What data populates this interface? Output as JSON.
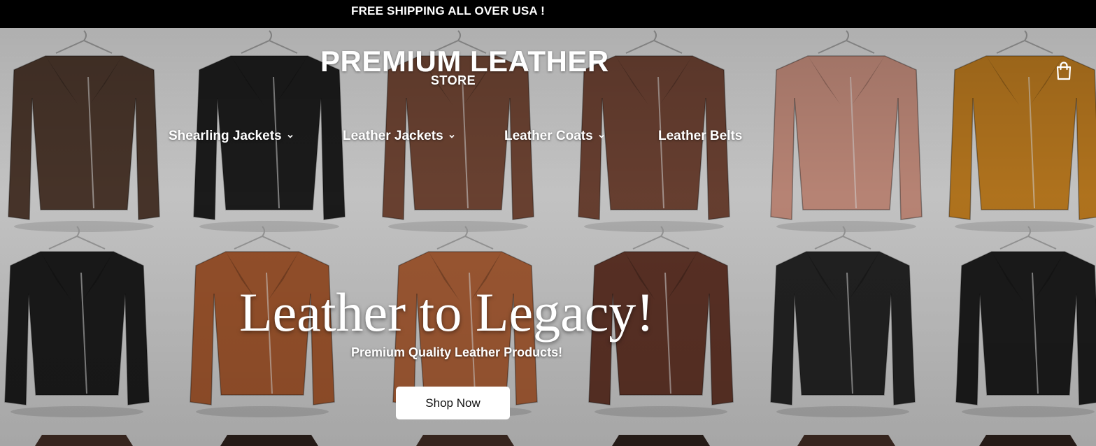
{
  "announcement": {
    "text": "FREE SHIPPING ALL OVER USA !"
  },
  "header": {
    "logo_line1": "PREMIUM LEATHER",
    "logo_line2": "STORE",
    "cart_icon": "shopping-bag-icon"
  },
  "nav": {
    "items": [
      {
        "label": "Shearling Jackets",
        "has_dropdown": true
      },
      {
        "label": "Leather Jackets",
        "has_dropdown": true
      },
      {
        "label": "Leather Coats",
        "has_dropdown": true
      },
      {
        "label": "Leather Belts",
        "has_dropdown": false
      }
    ]
  },
  "hero": {
    "headline": "Leather to Legacy!",
    "subheadline": "Premium Quality Leather Products!",
    "cta_label": "Shop Now",
    "jacket_colors": {
      "row1": [
        "#4a362b",
        "#1c1c1c",
        "#6e4433",
        "#6b4132",
        "#c08a7a",
        "#b8781f"
      ],
      "row2": [
        "#1a1a1a",
        "#9a532c",
        "#a15a34",
        "#5c3226",
        "#222222",
        "#1b1b1b"
      ]
    }
  }
}
